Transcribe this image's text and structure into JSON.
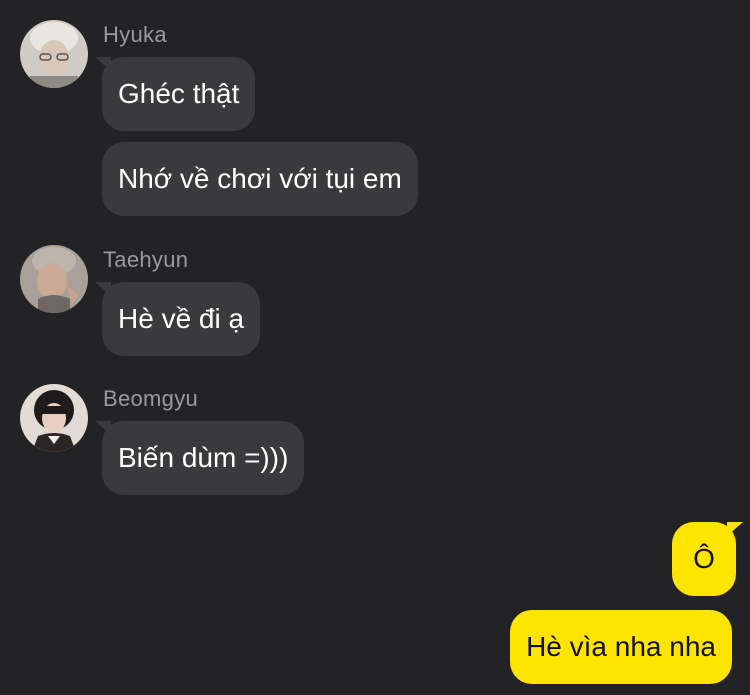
{
  "messages": [
    {
      "sender": "Hyuka",
      "bubbles": [
        "Ghéc thật",
        "Nhớ về chơi với tụi em"
      ]
    },
    {
      "sender": "Taehyun",
      "bubbles": [
        "Hè về đi ạ"
      ]
    },
    {
      "sender": "Beomgyu",
      "bubbles": [
        "Biến dùm =)))"
      ]
    }
  ],
  "my_messages": [
    "Ô",
    "Hè vìa nha nha"
  ],
  "colors": {
    "background": "#232325",
    "incoming_bubble": "#3a3a3c",
    "outgoing_bubble": "#fee500",
    "sender_name": "#9a9a9e"
  }
}
